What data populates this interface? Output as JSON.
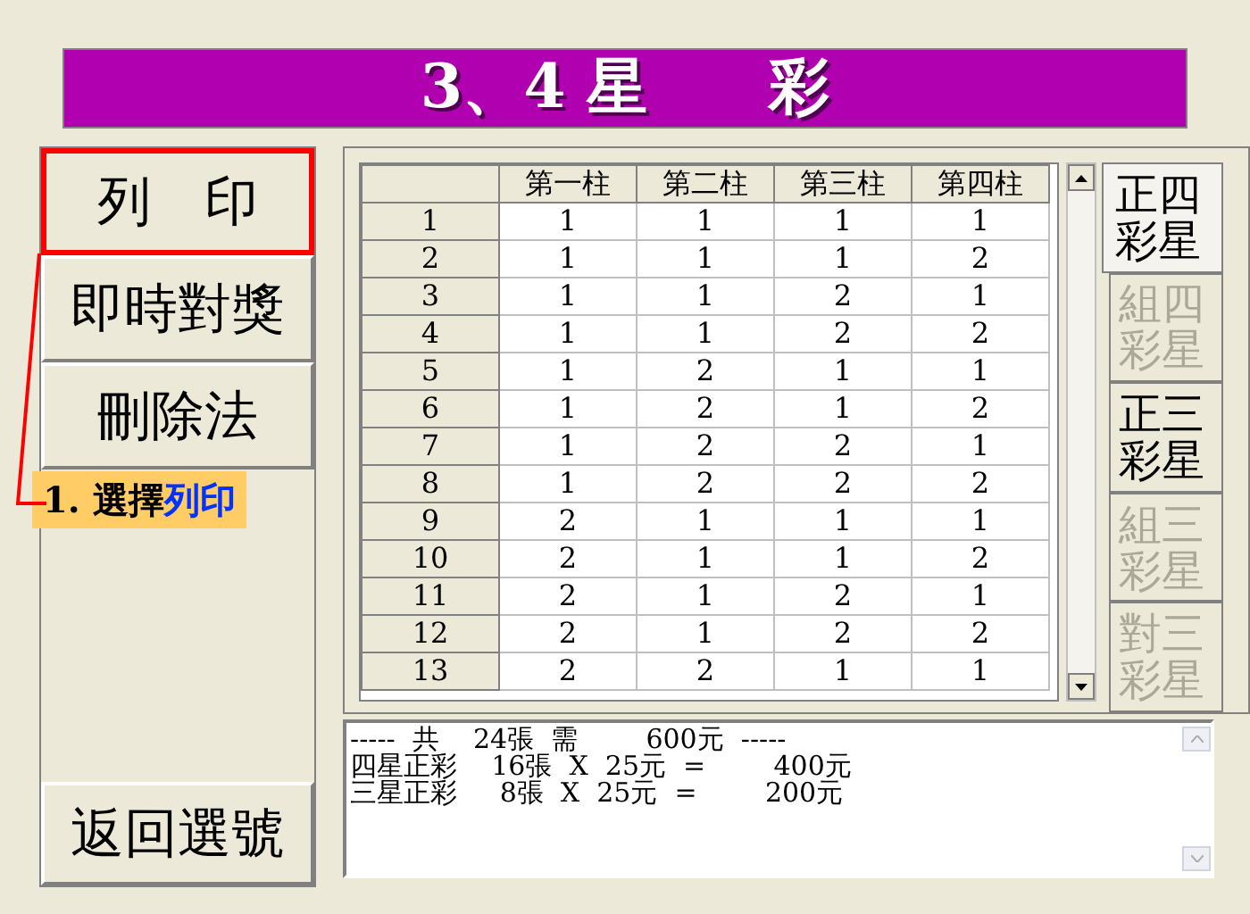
{
  "title": "3、4 星　　彩",
  "menu": [
    {
      "label": "列　印",
      "highlighted": true
    },
    {
      "label": "即時對獎",
      "highlighted": false
    },
    {
      "label": "刪除法",
      "highlighted": false
    }
  ],
  "back_button": "返回選號",
  "callout": {
    "prefix": "1. 選擇",
    "highlight": "列印"
  },
  "table": {
    "columns": [
      "第一柱",
      "第二柱",
      "第三柱",
      "第四柱"
    ],
    "rows": [
      {
        "n": "1",
        "cells": [
          "1",
          "1",
          "1",
          "1"
        ]
      },
      {
        "n": "2",
        "cells": [
          "1",
          "1",
          "1",
          "2"
        ]
      },
      {
        "n": "3",
        "cells": [
          "1",
          "1",
          "2",
          "1"
        ]
      },
      {
        "n": "4",
        "cells": [
          "1",
          "1",
          "2",
          "2"
        ]
      },
      {
        "n": "5",
        "cells": [
          "1",
          "2",
          "1",
          "1"
        ]
      },
      {
        "n": "6",
        "cells": [
          "1",
          "2",
          "1",
          "2"
        ]
      },
      {
        "n": "7",
        "cells": [
          "1",
          "2",
          "2",
          "1"
        ]
      },
      {
        "n": "8",
        "cells": [
          "1",
          "2",
          "2",
          "2"
        ]
      },
      {
        "n": "9",
        "cells": [
          "2",
          "1",
          "1",
          "1"
        ]
      },
      {
        "n": "10",
        "cells": [
          "2",
          "1",
          "1",
          "2"
        ]
      },
      {
        "n": "11",
        "cells": [
          "2",
          "1",
          "2",
          "1"
        ]
      },
      {
        "n": "12",
        "cells": [
          "2",
          "1",
          "2",
          "2"
        ]
      },
      {
        "n": "13",
        "cells": [
          "2",
          "2",
          "1",
          "1"
        ]
      }
    ]
  },
  "tabs": [
    {
      "label": "正四彩星",
      "selected": true,
      "disabled": false
    },
    {
      "label": "組四彩星",
      "selected": false,
      "disabled": true
    },
    {
      "label": "正三彩星",
      "selected": false,
      "disabled": false
    },
    {
      "label": "組三彩星",
      "selected": false,
      "disabled": true
    },
    {
      "label": "對三彩星",
      "selected": false,
      "disabled": true
    }
  ],
  "summary": [
    "-----  共    24張  需        600元  -----",
    "四星正彩    16張  X  25元  =        400元",
    "三星正彩     8張  X  25元  =        200元"
  ]
}
